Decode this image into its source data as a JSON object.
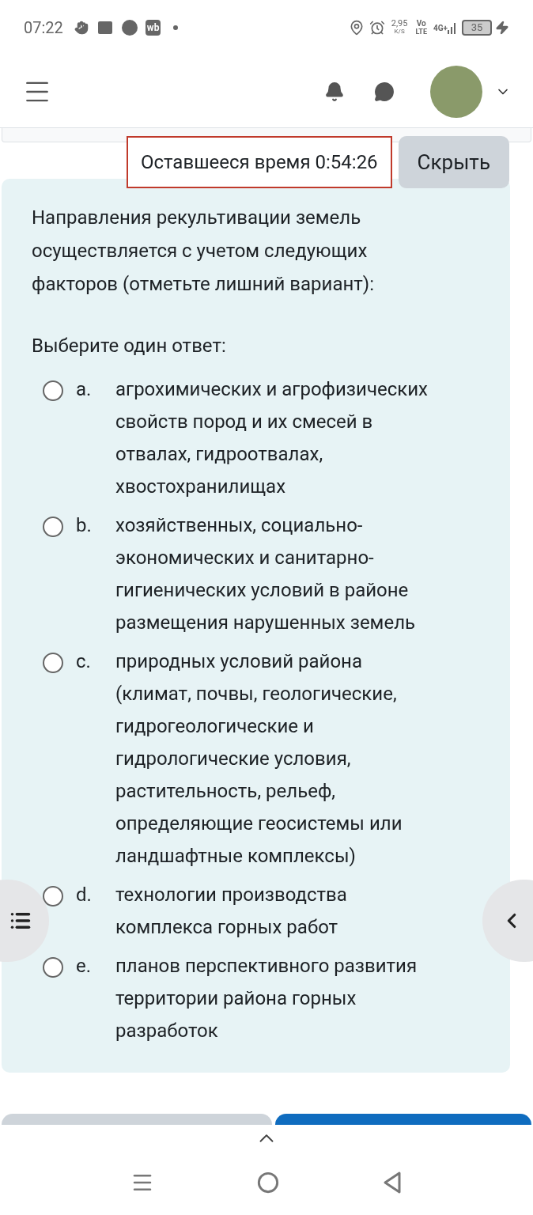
{
  "status_bar": {
    "time": "07:22",
    "app_badge": "wb",
    "speed_value": "2,95",
    "speed_unit": "K/S",
    "volte_top": "Vo",
    "volte_bottom": "LTE",
    "network": "4G+",
    "battery": "35"
  },
  "timer": {
    "label": "Оставшееся время 0:54:26",
    "hide_button": "Скрыть"
  },
  "question": {
    "text": "Направления рекультивации земель осуществляется с учетом следующих факторов (отметьте лишний вариант):",
    "prompt": "Выберите один ответ:",
    "options": [
      {
        "letter": "a.",
        "text": "агрохимических и агрофизических свойств пород и их смесей в отвалах, гидроотвалах, хвостохранилищах",
        "selected": false
      },
      {
        "letter": "b.",
        "text": "хозяйственных, социально-экономических и санитарно-гигиенических условий в районе размещения нарушенных земель",
        "selected": false
      },
      {
        "letter": "c.",
        "text": "природных условий района (климат, почвы, геологические, гидрогеологические и гидрологические условия, растительность, рельеф, определяющие геосистемы или ландшафтные комплексы)",
        "selected": false
      },
      {
        "letter": "d.",
        "text": "технологии производства комплекса горных работ",
        "selected": false
      },
      {
        "letter": "e.",
        "text": "планов перспективного развития территории района горных разработок",
        "selected": false
      }
    ]
  }
}
